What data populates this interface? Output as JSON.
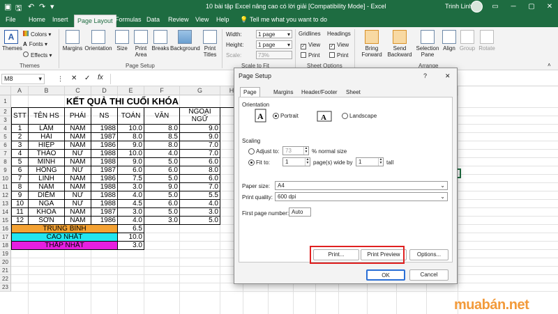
{
  "window": {
    "title": "10 bài tập Excel nâng cao có lời giải  [Compatibility Mode]  -  Excel",
    "user": "Trinh Linh"
  },
  "tabs": [
    "File",
    "Home",
    "Insert",
    "Page Layout",
    "Formulas",
    "Data",
    "Review",
    "View",
    "Help"
  ],
  "tell_me": "Tell me what you want to do",
  "ribbon": {
    "themes": {
      "label": "Themes",
      "group": "Themes",
      "colors": "Colors",
      "fonts": "Fonts",
      "effects": "Effects"
    },
    "page_setup": {
      "group": "Page Setup",
      "buttons": [
        "Margins",
        "Orientation",
        "Size",
        "Print Area",
        "Breaks",
        "Background",
        "Print Titles"
      ]
    },
    "scale": {
      "group": "Scale to Fit",
      "width_label": "Width:",
      "width_value": "1 page",
      "height_label": "Height:",
      "height_value": "1 page",
      "scale_label": "Scale:",
      "scale_value": "73%"
    },
    "sheet_options": {
      "group": "Sheet Options",
      "gridlines": "Gridlines",
      "headings": "Headings",
      "view": "View",
      "print": "Print"
    },
    "arrange": {
      "group": "Arrange",
      "buttons": [
        "Bring Forward",
        "Send Backward",
        "Selection Pane",
        "Align",
        "Group",
        "Rotate"
      ]
    }
  },
  "formula_bar": {
    "name_box": "M8",
    "fx": "fx"
  },
  "columns": [
    "A",
    "B",
    "C",
    "D",
    "E",
    "F",
    "G",
    "H",
    "I",
    "J",
    "K",
    "L",
    "M",
    "N",
    "O",
    "P"
  ],
  "rows": [
    "1",
    "2",
    "3",
    "4",
    "5",
    "6",
    "7",
    "8",
    "9",
    "10",
    "11",
    "12",
    "13",
    "14",
    "15",
    "16",
    "17",
    "18",
    "19",
    "20",
    "21",
    "22",
    "23"
  ],
  "sheet": {
    "title": "KẾT QUẢ THI CUỐI KHÓA",
    "headers": [
      "STT",
      "TÊN HS",
      "PHÁI",
      "NS",
      "TOÁN",
      "VĂN",
      "NGOẠI NGỮ"
    ],
    "data": [
      [
        "1",
        "LẮM",
        "NAM",
        "1988",
        "10.0",
        "8.0",
        "9.0"
      ],
      [
        "2",
        "HẢI",
        "NAM",
        "1987",
        "8.0",
        "8.5",
        "9.0"
      ],
      [
        "3",
        "HIỆP",
        "NAM",
        "1986",
        "9.0",
        "8.0",
        "7.0"
      ],
      [
        "4",
        "THẢO",
        "NỮ",
        "1988",
        "10.0",
        "4.0",
        "7.0"
      ],
      [
        "5",
        "MINH",
        "NAM",
        "1988",
        "9.0",
        "5.0",
        "6.0"
      ],
      [
        "6",
        "HỒNG",
        "NỮ",
        "1987",
        "6.0",
        "6.0",
        "8.0"
      ],
      [
        "7",
        "LINH",
        "NAM",
        "1986",
        "7.5",
        "5.0",
        "6.0"
      ],
      [
        "8",
        "NAM",
        "NAM",
        "1988",
        "3.0",
        "9.0",
        "7.0"
      ],
      [
        "9",
        "DIỄM",
        "NỮ",
        "1988",
        "4.0",
        "5.0",
        "5.5"
      ],
      [
        "10",
        "NGA",
        "NỮ",
        "1988",
        "4.5",
        "6.0",
        "4.0"
      ],
      [
        "11",
        "KHOA",
        "NAM",
        "1987",
        "3.0",
        "5.0",
        "3.0"
      ],
      [
        "12",
        "SƠN",
        "NAM",
        "1986",
        "4.0",
        "3.0",
        "5.0"
      ]
    ],
    "summary": [
      {
        "label": "TRUNG BÌNH",
        "value": "6.5",
        "color": "#f4a233"
      },
      {
        "label": "CAO NHẤT",
        "value": "10.0",
        "color": "#22e5ef"
      },
      {
        "label": "THẤP NHẤT",
        "value": "3.0",
        "color": "#e61fe0"
      }
    ]
  },
  "dialog": {
    "title": "Page Setup",
    "help": "?",
    "close": "✕",
    "tabs": [
      "Page",
      "Margins",
      "Header/Footer",
      "Sheet"
    ],
    "orientation_label": "Orientation",
    "portrait": "Portrait",
    "landscape": "Landscape",
    "scaling_label": "Scaling",
    "adjust_to": "Adjust to:",
    "adjust_value": "73",
    "normal_size": "% normal size",
    "fit_to": "Fit to:",
    "fit_wide": "1",
    "pages_wide_by": "page(s) wide by",
    "fit_tall": "1",
    "tall": "tall",
    "paper_size_label": "Paper size:",
    "paper_size": "A4",
    "print_quality_label": "Print quality:",
    "print_quality": "600 dpi",
    "first_page_label": "First page number:",
    "first_page": "Auto",
    "print_btn": "Print...",
    "preview_btn": "Print Preview",
    "options_btn": "Options...",
    "ok_btn": "OK",
    "cancel_btn": "Cancel"
  },
  "watermark": "muabán.net",
  "colors": {
    "excel_green": "#1e6c41",
    "arrow_red": "#e02020",
    "watermark": "#f29a3a"
  }
}
